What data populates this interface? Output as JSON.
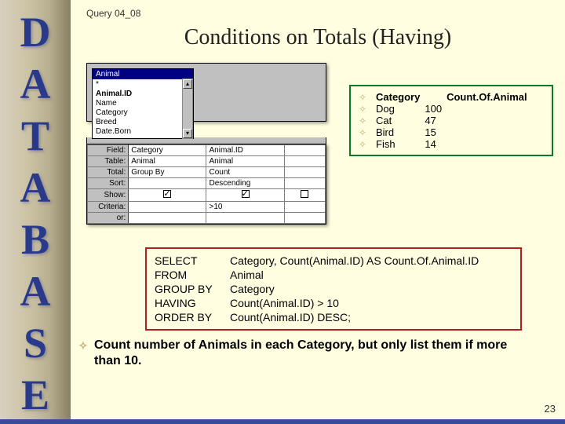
{
  "sidebar": {
    "letters": [
      "D",
      "A",
      "T",
      "A",
      "B",
      "A",
      "S",
      "E"
    ]
  },
  "header": {
    "query_id": "Query 04_08",
    "title": "Conditions on Totals (Having)"
  },
  "qbe_table": {
    "name": "Animal",
    "star": "*",
    "fields_list": [
      "Animal.ID",
      "Name",
      "Category",
      "Breed",
      "Date.Born"
    ],
    "rows": {
      "Field": {
        "col1": "Category",
        "col2": "Animal.ID",
        "col3": ""
      },
      "Table": {
        "col1": "Animal",
        "col2": "Animal",
        "col3": ""
      },
      "Total": {
        "col1": "Group By",
        "col2": "Count",
        "col3": ""
      },
      "Sort": {
        "col1": "",
        "col2": "Descending",
        "col3": ""
      },
      "Show": {
        "col1": true,
        "col2": true,
        "col3": false
      },
      "Criteria": {
        "col1": "",
        "col2": ">10",
        "col3": ""
      },
      "or": {
        "col1": "",
        "col2": "",
        "col3": ""
      }
    },
    "labels": {
      "Field": "Field:",
      "Table": "Table:",
      "Total": "Total:",
      "Sort": "Sort:",
      "Show": "Show:",
      "Criteria": "Criteria:",
      "or": "or:"
    }
  },
  "results": {
    "headers": [
      "Category",
      "Count.Of.Animal"
    ],
    "rows": [
      {
        "cat": "Dog",
        "count": "100"
      },
      {
        "cat": "Cat",
        "count": "47"
      },
      {
        "cat": "Bird",
        "count": "15"
      },
      {
        "cat": "Fish",
        "count": "14"
      }
    ]
  },
  "sql": {
    "lines": [
      {
        "kw": "SELECT",
        "rest": "Category, Count(Animal.ID) AS Count.Of.Animal.ID"
      },
      {
        "kw": "FROM",
        "rest": "Animal"
      },
      {
        "kw": "GROUP BY",
        "rest": "Category"
      },
      {
        "kw": "HAVING",
        "rest": "Count(Animal.ID) > 10"
      },
      {
        "kw": "ORDER BY",
        "rest": "Count(Animal.ID) DESC;"
      }
    ]
  },
  "summary": "Count number of Animals in each Category, but only list them if more than 10.",
  "page_number": "23"
}
